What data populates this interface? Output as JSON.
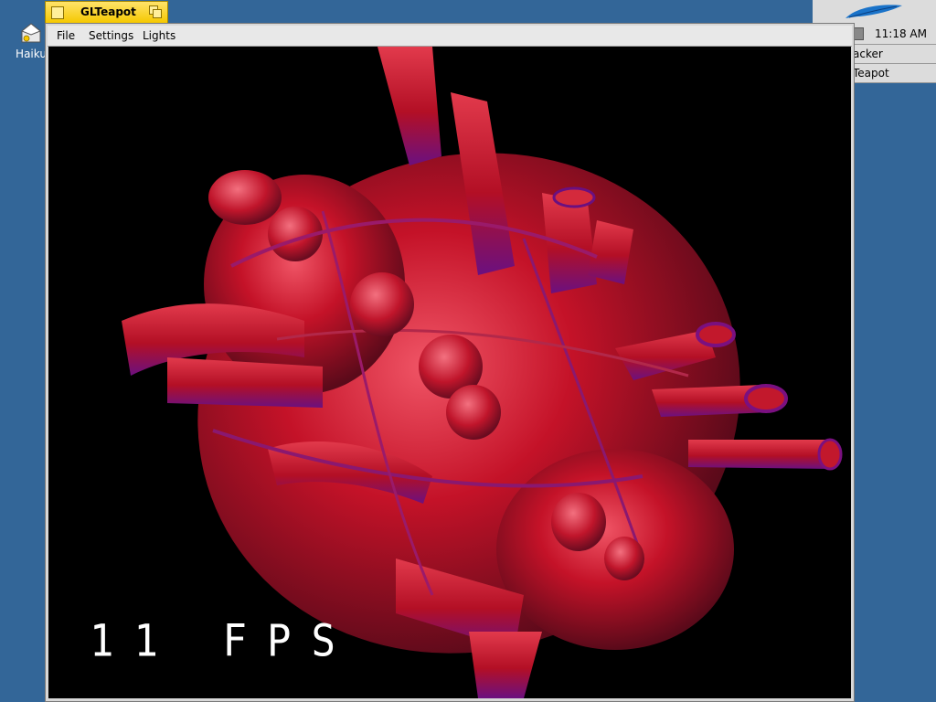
{
  "desktop": {
    "icon_label": "Haiku"
  },
  "deskbar": {
    "clock": "11:18 AM",
    "items": [
      {
        "label": "acker"
      },
      {
        "label": "Teapot"
      }
    ]
  },
  "window": {
    "title": "GLTeapot",
    "menus": [
      "File",
      "Settings",
      "Lights"
    ],
    "fps_text": "11 FPS"
  },
  "colors": {
    "desktop": "#336698",
    "tab": "#f5c800",
    "model_red": "#c4142a",
    "model_shadow": "#6a1aa0"
  }
}
